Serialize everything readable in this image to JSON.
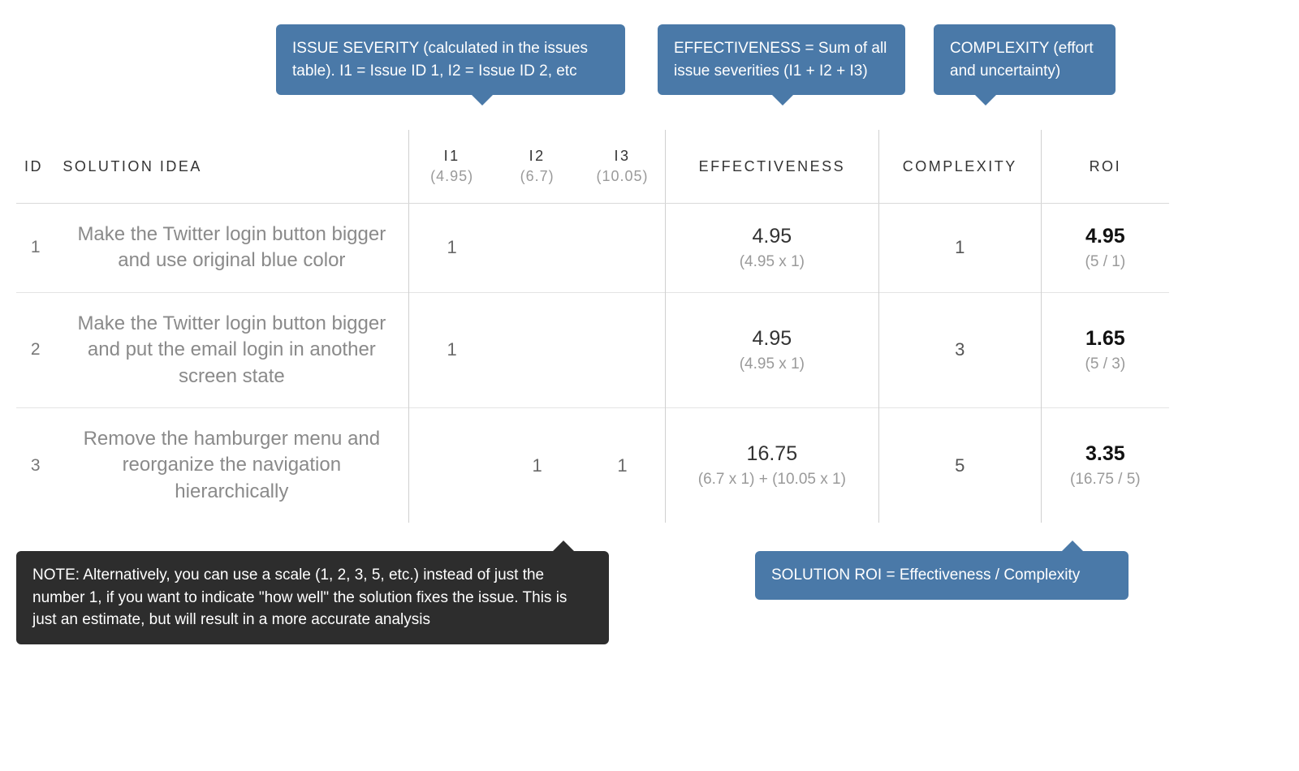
{
  "callouts": {
    "severity": "ISSUE SEVERITY (calculated in the issues table). I1 = Issue ID 1, I2 = Issue ID 2, etc",
    "effectiveness": "EFFECTIVENESS = Sum of all issue severities (I1 + I2 + I3)",
    "complexity": "COMPLEXITY (effort and uncertainty)",
    "note": "NOTE: Alternatively, you can use a scale (1, 2, 3, 5, etc.) instead of just the number 1, if you want to indicate \"how well\" the solution fixes the issue. This is just an estimate, but will result in a more accurate analysis",
    "roi": "SOLUTION ROI = Effectiveness / Complexity"
  },
  "headers": {
    "id": "ID",
    "solution_idea": "SOLUTION IDEA",
    "i1": "I1",
    "i1_sub": "(4.95)",
    "i2": "I2",
    "i2_sub": "(6.7)",
    "i3": "I3",
    "i3_sub": "(10.05)",
    "effectiveness": "EFFECTIVENESS",
    "complexity": "COMPLEXITY",
    "roi": "ROI"
  },
  "rows": [
    {
      "id": "1",
      "idea": "Make the Twitter login button bigger and use original blue color",
      "i1": "1",
      "i2": "",
      "i3": "",
      "eff_value": "4.95",
      "eff_calc": "(4.95 x 1)",
      "complexity": "1",
      "roi_value": "4.95",
      "roi_calc": "(5 / 1)"
    },
    {
      "id": "2",
      "idea": "Make the Twitter login button bigger and put the email login in another screen state",
      "i1": "1",
      "i2": "",
      "i3": "",
      "eff_value": "4.95",
      "eff_calc": "(4.95 x 1)",
      "complexity": "3",
      "roi_value": "1.65",
      "roi_calc": "(5 / 3)"
    },
    {
      "id": "3",
      "idea": "Remove the hamburger menu and reorganize the navigation hierarchically",
      "i1": "",
      "i2": "1",
      "i3": "1",
      "eff_value": "16.75",
      "eff_calc": "(6.7 x 1) + (10.05 x 1)",
      "complexity": "5",
      "roi_value": "3.35",
      "roi_calc": "(16.75 / 5)"
    }
  ],
  "chart_data": {
    "type": "table",
    "issues": {
      "I1": 4.95,
      "I2": 6.7,
      "I3": 10.05
    },
    "solutions": [
      {
        "id": 1,
        "marks": {
          "I1": 1
        },
        "effectiveness": 4.95,
        "complexity": 1,
        "roi": 4.95
      },
      {
        "id": 2,
        "marks": {
          "I1": 1
        },
        "effectiveness": 4.95,
        "complexity": 3,
        "roi": 1.65
      },
      {
        "id": 3,
        "marks": {
          "I2": 1,
          "I3": 1
        },
        "effectiveness": 16.75,
        "complexity": 5,
        "roi": 3.35
      }
    ],
    "formulas": {
      "effectiveness": "sum of issue severities addressed",
      "roi": "Effectiveness / Complexity"
    }
  }
}
